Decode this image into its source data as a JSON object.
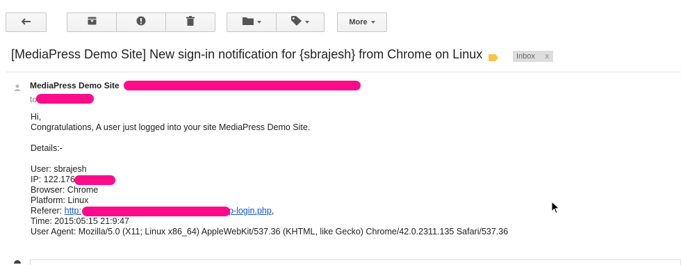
{
  "toolbar": {
    "reply_icon": "reply-icon",
    "archive_icon": "archive-icon",
    "spam_icon": "report-spam-icon",
    "delete_icon": "trash-icon",
    "move_icon": "folder-icon",
    "labels_icon": "tag-icon",
    "more_label": "More"
  },
  "subject": "[MediaPress Demo Site] New sign-in notification for {sbrajesh} from Chrome on Linux",
  "label_color": "#f7c34a",
  "inbox_chip": {
    "label": "Inbox",
    "remove": "x"
  },
  "message": {
    "sender_name": "MediaPress Demo Site",
    "to_prefix": "to",
    "greeting": "Hi,",
    "intro": "Congratulations, A user just logged into your site MediaPress Demo Site.",
    "details_heading": "Details:-",
    "user_line": "User: sbrajesh",
    "ip_prefix": "IP: 122.176",
    "browser_line": "Browser: Chrome",
    "platform_line": "Platform: Linux",
    "referer_prefix": "Referer: ",
    "referer_link_start": "http:",
    "referer_link_end": "p-login.php",
    "referer_suffix": ",",
    "time_line": "Time: 2015:05:15 21:9:47",
    "user_agent_line": "User Agent: Mozilla/5.0 (X11; Linux x86_64) AppleWebKit/537.36 (KHTML, like Gecko) Chrome/42.0.2311.135 Safari/537.36"
  },
  "colors": {
    "redaction": "#ff0c8a",
    "link": "#1155cc"
  }
}
